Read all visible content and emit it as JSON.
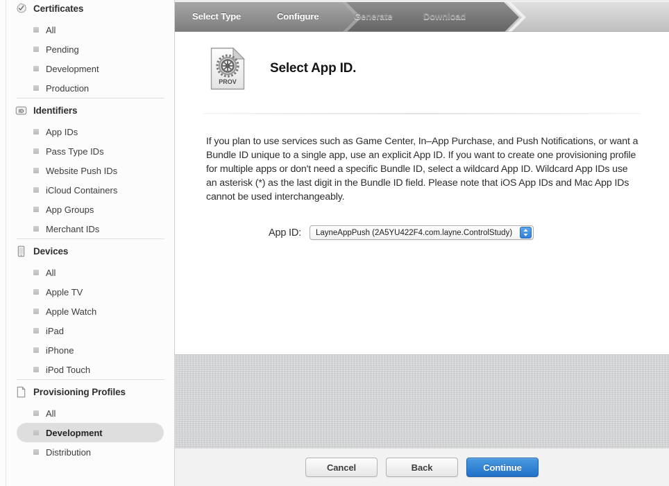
{
  "sidebar": {
    "groups": [
      {
        "id": "certificates",
        "label": "Certificates",
        "icon": "certificate-seal-icon",
        "items": [
          {
            "label": "All",
            "selected": false
          },
          {
            "label": "Pending",
            "selected": false
          },
          {
            "label": "Development",
            "selected": false
          },
          {
            "label": "Production",
            "selected": false
          }
        ]
      },
      {
        "id": "identifiers",
        "label": "Identifiers",
        "icon": "id-badge-icon",
        "items": [
          {
            "label": "App IDs",
            "selected": false
          },
          {
            "label": "Pass Type IDs",
            "selected": false
          },
          {
            "label": "Website Push IDs",
            "selected": false
          },
          {
            "label": "iCloud Containers",
            "selected": false
          },
          {
            "label": "App Groups",
            "selected": false
          },
          {
            "label": "Merchant IDs",
            "selected": false
          }
        ]
      },
      {
        "id": "devices",
        "label": "Devices",
        "icon": "mobile-device-icon",
        "items": [
          {
            "label": "All",
            "selected": false
          },
          {
            "label": "Apple TV",
            "selected": false
          },
          {
            "label": "Apple Watch",
            "selected": false
          },
          {
            "label": "iPad",
            "selected": false
          },
          {
            "label": "iPhone",
            "selected": false
          },
          {
            "label": "iPod Touch",
            "selected": false
          }
        ]
      },
      {
        "id": "provisioning-profiles",
        "label": "Provisioning Profiles",
        "icon": "document-page-icon",
        "items": [
          {
            "label": "All",
            "selected": false
          },
          {
            "label": "Development",
            "selected": true
          },
          {
            "label": "Distribution",
            "selected": false
          }
        ]
      }
    ]
  },
  "steps": [
    {
      "label": "Select Type",
      "state": "done"
    },
    {
      "label": "Configure",
      "state": "active"
    },
    {
      "label": "Generate",
      "state": "todo"
    },
    {
      "label": "Download",
      "state": "todo"
    }
  ],
  "content": {
    "icon_caption": "PROV",
    "icon_name": "provisioning-profile-file-icon",
    "title": "Select App ID.",
    "blurb": "If you plan to use services such as Game Center, In–App Purchase, and Push Notifications, or want a Bundle ID unique to a single app, use an explicit App ID. If you want to create one provisioning profile for multiple apps or don't need a specific Bundle ID, select a wildcard App ID. Wildcard App IDs use an asterisk (*) as the last digit in the Bundle ID field. Please note that iOS App IDs and Mac App IDs cannot be used interchangeably.",
    "field": {
      "label": "App ID:",
      "value": "LayneAppPush (2A5YU422F4.com.layne.ControlStudy)",
      "options": [
        "LayneAppPush (2A5YU422F4.com.layne.ControlStudy)"
      ]
    }
  },
  "footer": {
    "cancel_label": "Cancel",
    "back_label": "Back",
    "continue_label": "Continue"
  },
  "colors": {
    "accent_blue": "#2f7fd6",
    "step_done": "#8d8d8d",
    "step_active": "#6e6e6e",
    "step_todo": "#c8c8c8",
    "selected_row": "#dedede",
    "texture_gray": "#d2d3d5"
  }
}
